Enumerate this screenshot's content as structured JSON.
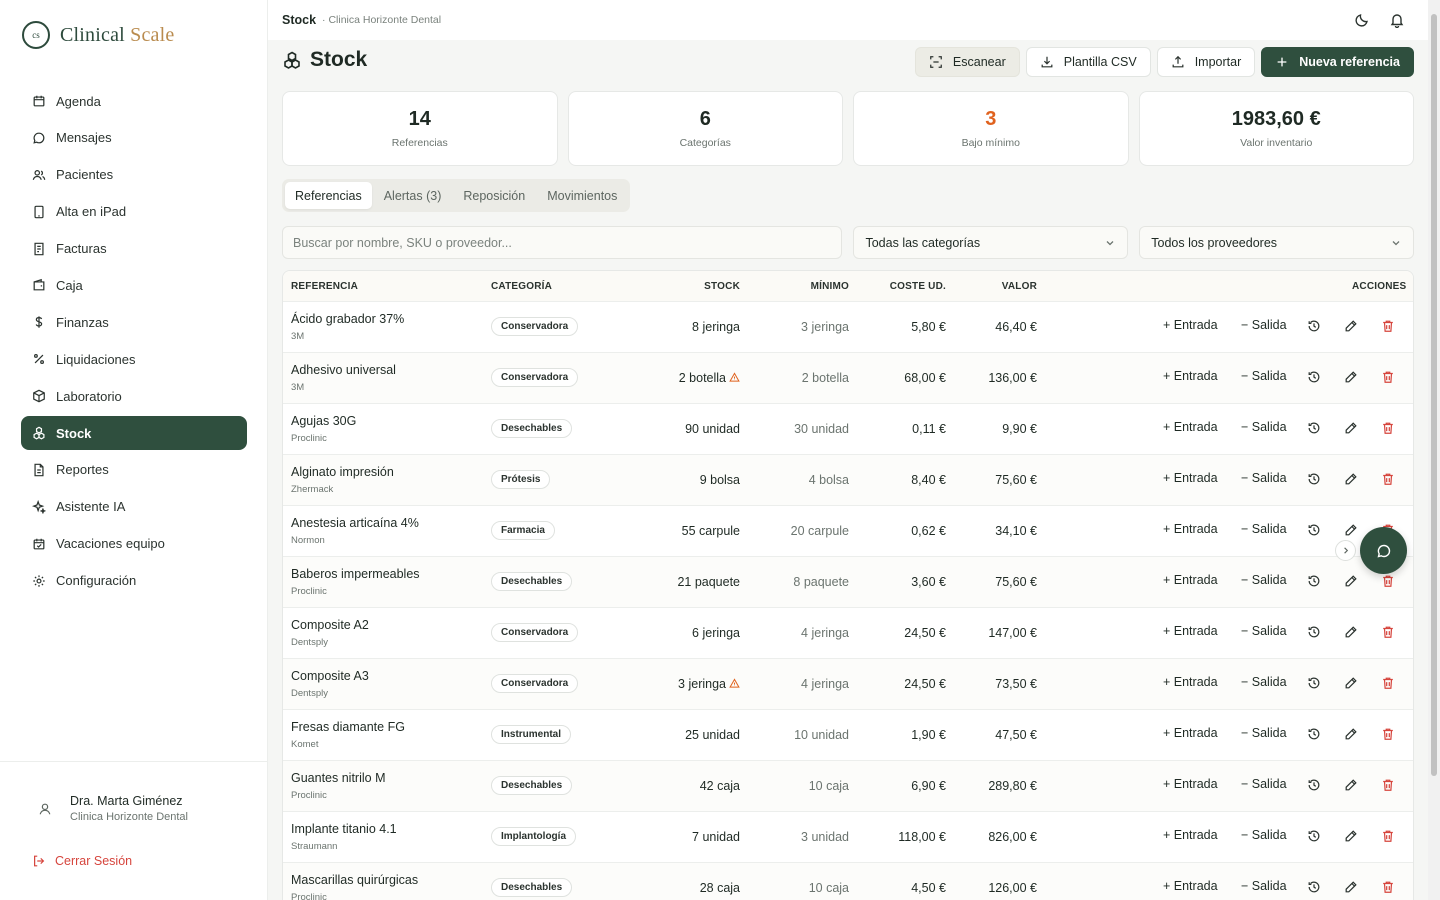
{
  "app": {
    "logo_mark": "cs",
    "logo_text_a": "Clinical",
    "logo_text_b": "Scale"
  },
  "sidebar": {
    "items": [
      {
        "label": "Agenda",
        "icon": "calendar-icon"
      },
      {
        "label": "Mensajes",
        "icon": "message-icon"
      },
      {
        "label": "Pacientes",
        "icon": "users-icon"
      },
      {
        "label": "Alta en iPad",
        "icon": "tablet-icon"
      },
      {
        "label": "Facturas",
        "icon": "invoice-icon"
      },
      {
        "label": "Caja",
        "icon": "wallet-icon"
      },
      {
        "label": "Finanzas",
        "icon": "dollar-icon"
      },
      {
        "label": "Liquidaciones",
        "icon": "percent-icon"
      },
      {
        "label": "Laboratorio",
        "icon": "box-icon"
      },
      {
        "label": "Stock",
        "icon": "boxes-icon",
        "active": true
      },
      {
        "label": "Reportes",
        "icon": "report-icon"
      },
      {
        "label": "Asistente IA",
        "icon": "sparkles-icon"
      },
      {
        "label": "Vacaciones equipo",
        "icon": "calendar-check-icon"
      },
      {
        "label": "Configuración",
        "icon": "gear-icon"
      }
    ],
    "user_name": "Dra. Marta Giménez",
    "user_clinic": "Clinica Horizonte Dental",
    "logout": "Cerrar Sesión"
  },
  "topbar": {
    "crumb": "Stock",
    "clinic": "· Clinica Horizonte Dental"
  },
  "header": {
    "title": "Stock",
    "buttons": {
      "scan": "Escanear",
      "csv": "Plantilla CSV",
      "import": "Importar",
      "new": "Nueva referencia"
    }
  },
  "stats": [
    {
      "value": "14",
      "label": "Referencias"
    },
    {
      "value": "6",
      "label": "Categorías"
    },
    {
      "value": "3",
      "label": "Bajo mínimo"
    },
    {
      "value": "1983,60 €",
      "label": "Valor inventario"
    }
  ],
  "tabs": [
    "Referencias",
    "Alertas (3)",
    "Reposición",
    "Movimientos"
  ],
  "filters": {
    "search_placeholder": "Buscar por nombre, SKU o proveedor...",
    "category": "Todas las categorías",
    "supplier": "Todos los proveedores"
  },
  "table": {
    "headers": {
      "ref": "REFERENCIA",
      "cat": "CATEGORÍA",
      "stock": "STOCK",
      "min": "MÍNIMO",
      "cost": "COSTE UD.",
      "value": "VALOR",
      "actions": "ACCIONES"
    },
    "entrada": "+ Entrada",
    "salida": "− Salida",
    "rows": [
      {
        "name": "Ácido grabador 37%",
        "supplier": "3M",
        "category": "Conservadora",
        "stock": "8 jeringa",
        "min": "3 jeringa",
        "cost": "5,80 €",
        "value": "46,40 €",
        "low": false
      },
      {
        "name": "Adhesivo universal",
        "supplier": "3M",
        "category": "Conservadora",
        "stock": "2 botella",
        "min": "2 botella",
        "cost": "68,00 €",
        "value": "136,00 €",
        "low": true
      },
      {
        "name": "Agujas 30G",
        "supplier": "Proclinic",
        "category": "Desechables",
        "stock": "90 unidad",
        "min": "30 unidad",
        "cost": "0,11 €",
        "value": "9,90 €",
        "low": false
      },
      {
        "name": "Alginato impresión",
        "supplier": "Zhermack",
        "category": "Prótesis",
        "stock": "9 bolsa",
        "min": "4 bolsa",
        "cost": "8,40 €",
        "value": "75,60 €",
        "low": false
      },
      {
        "name": "Anestesia articaína 4%",
        "supplier": "Normon",
        "category": "Farmacia",
        "stock": "55 carpule",
        "min": "20 carpule",
        "cost": "0,62 €",
        "value": "34,10 €",
        "low": false
      },
      {
        "name": "Baberos impermeables",
        "supplier": "Proclinic",
        "category": "Desechables",
        "stock": "21 paquete",
        "min": "8 paquete",
        "cost": "3,60 €",
        "value": "75,60 €",
        "low": false
      },
      {
        "name": "Composite A2",
        "supplier": "Dentsply",
        "category": "Conservadora",
        "stock": "6 jeringa",
        "min": "4 jeringa",
        "cost": "24,50 €",
        "value": "147,00 €",
        "low": false
      },
      {
        "name": "Composite A3",
        "supplier": "Dentsply",
        "category": "Conservadora",
        "stock": "3 jeringa",
        "min": "4 jeringa",
        "cost": "24,50 €",
        "value": "73,50 €",
        "low": true
      },
      {
        "name": "Fresas diamante FG",
        "supplier": "Komet",
        "category": "Instrumental",
        "stock": "25 unidad",
        "min": "10 unidad",
        "cost": "1,90 €",
        "value": "47,50 €",
        "low": false
      },
      {
        "name": "Guantes nitrilo M",
        "supplier": "Proclinic",
        "category": "Desechables",
        "stock": "42 caja",
        "min": "10 caja",
        "cost": "6,90 €",
        "value": "289,80 €",
        "low": false
      },
      {
        "name": "Implante titanio 4.1",
        "supplier": "Straumann",
        "category": "Implantología",
        "stock": "7 unidad",
        "min": "3 unidad",
        "cost": "118,00 €",
        "value": "826,00 €",
        "low": false
      },
      {
        "name": "Mascarillas quirúrgicas",
        "supplier": "Proclinic",
        "category": "Desechables",
        "stock": "28 caja",
        "min": "10 caja",
        "cost": "4,50 €",
        "value": "126,00 €",
        "low": false
      }
    ]
  },
  "colors": {
    "brand": "#2f4f3e",
    "accent": "#b98b4e",
    "warn": "#e0621e",
    "danger": "#d6453d"
  }
}
